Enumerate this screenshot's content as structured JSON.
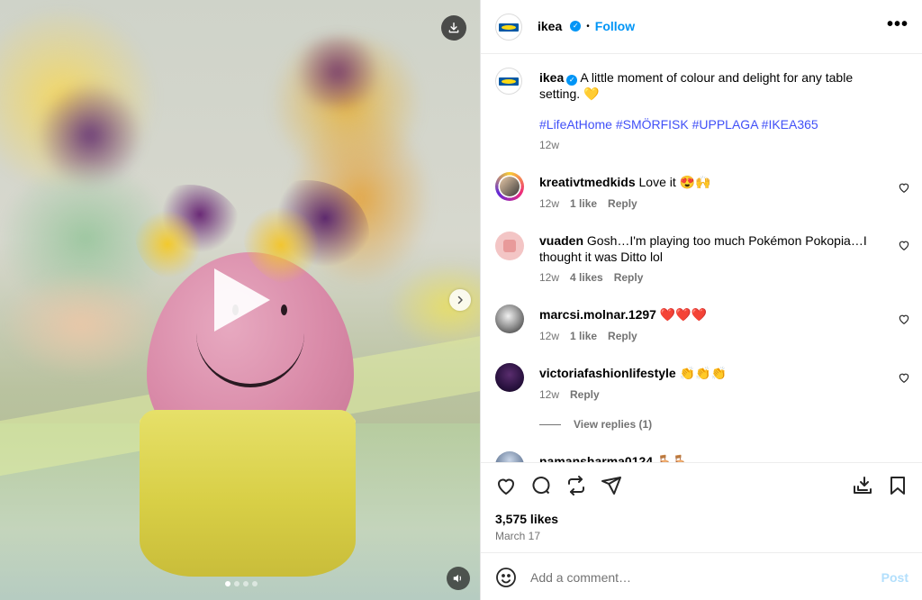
{
  "media": {
    "slides_total": 4,
    "slide_active": 1
  },
  "header": {
    "username": "ikea",
    "separator": "•",
    "follow_label": "Follow",
    "more_label": "•••"
  },
  "caption": {
    "username": "ikea",
    "text": "A little moment of colour and delight for any table setting. 💛",
    "hashtags": "#LifeAtHome #SMÖRFISK #UPPLAGA #IKEA365",
    "time": "12w"
  },
  "comments": [
    {
      "username": "kreativtmedkids",
      "text": "Love it 😍🙌",
      "time": "12w",
      "likes": "1 like",
      "reply": "Reply"
    },
    {
      "username": "vuaden",
      "text": "Gosh…I'm playing too much Pokémon Pokopia…I thought it was Ditto lol",
      "time": "12w",
      "likes": "4 likes",
      "reply": "Reply"
    },
    {
      "username": "marcsi.molnar.1297",
      "text": "❤️❤️❤️",
      "time": "12w",
      "likes": "1 like",
      "reply": "Reply"
    },
    {
      "username": "victoriafashionlifestyle",
      "text": "👏👏👏",
      "time": "12w",
      "likes": "",
      "reply": "Reply"
    }
  ],
  "view_replies": "View replies (1)",
  "partial_comment": {
    "username": "namansharma0124",
    "text": "🪑🪑"
  },
  "post": {
    "likes": "3,575 likes",
    "date": "March 17"
  },
  "add_comment": {
    "placeholder": "Add a comment…",
    "post_label": "Post"
  },
  "colors": {
    "accent": "#0095f6",
    "hashtag": "#4150f7",
    "muted": "#737373",
    "post_disabled": "#b2dffc"
  }
}
